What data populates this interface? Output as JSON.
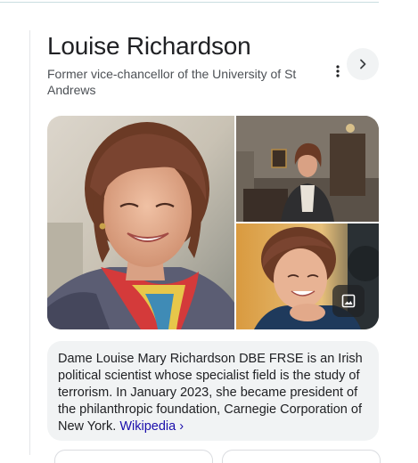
{
  "knowledge_panel": {
    "title": "Louise Richardson",
    "subtitle": "Former vice-chancellor of the University of St Andrews",
    "more_icon": "three-dot-vertical-icon",
    "next_icon": "chevron-right-icon",
    "image_search_icon": "image-icon",
    "description": "Dame Louise Mary Richardson DBE FRSE is an Irish political scientist whose specialist field is the study of terrorism. In January 2023, she became president of the philanthropic foundation, Carnegie Corporation of New York.",
    "source_link": "Wikipedia",
    "source_link_suffix": "›"
  },
  "colors": {
    "link": "#1a0dab",
    "card_bg": "#f1f3f4",
    "title": "#202124",
    "subtitle": "#4d5156"
  }
}
